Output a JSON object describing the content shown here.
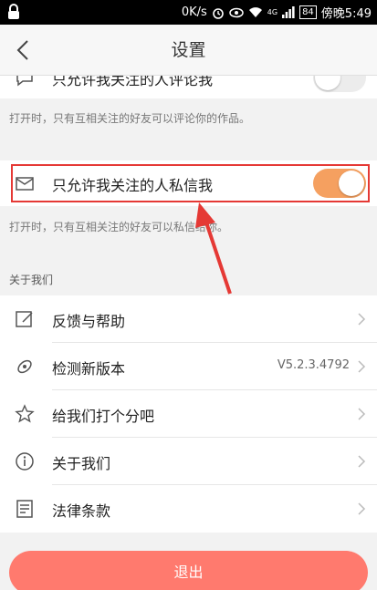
{
  "status_bar": {
    "speed": "0K/s",
    "network": "4G",
    "battery": "84",
    "time": "傍晚5:49"
  },
  "nav": {
    "title": "设置"
  },
  "privacy": {
    "comment_setting_label": "只允许我关注的人评论我",
    "comment_hint": "打开时，只有互相关注的好友可以评论你的作品。",
    "message_setting_label": "只允许我关注的人私信我",
    "message_hint": "打开时，只有互相关注的好友可以私信给你。",
    "comment_toggle_on": false,
    "message_toggle_on": true
  },
  "about_section": {
    "title": "关于我们",
    "items": [
      {
        "label": "反馈与帮助",
        "icon": "edit-icon"
      },
      {
        "label": "检测新版本",
        "icon": "satellite-icon",
        "value": "V5.2.3.4792"
      },
      {
        "label": "给我们打个分吧",
        "icon": "star-icon"
      },
      {
        "label": "关于我们",
        "icon": "info-icon"
      },
      {
        "label": "法律条款",
        "icon": "document-icon"
      }
    ]
  },
  "logout_label": "退出",
  "colors": {
    "accent": "#f5a060",
    "logout": "#ff7a6e",
    "highlight": "#e53935"
  }
}
